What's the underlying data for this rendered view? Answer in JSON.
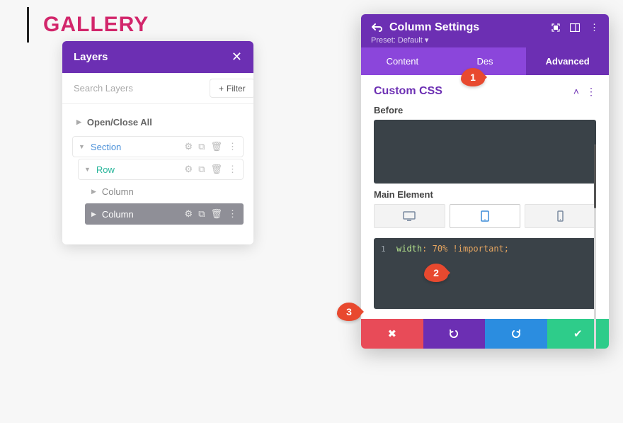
{
  "page_title": "GALLERY",
  "layers": {
    "title": "Layers",
    "search_placeholder": "Search Layers",
    "filter_label": "Filter",
    "open_close": "Open/Close All",
    "tree": {
      "section": "Section",
      "row": "Row",
      "column_a": "Column",
      "column_b": "Column"
    }
  },
  "settings": {
    "back_icon": "back",
    "title": "Column Settings",
    "preset_label": "Preset: Default",
    "tabs": {
      "content": "Content",
      "design_partial": "Des",
      "advanced": "Advanced"
    },
    "section_name": "Custom CSS",
    "before_label": "Before",
    "main_element_label": "Main Element",
    "code": {
      "line_no": "1",
      "prop": "width",
      "colon": ":",
      "value": "70%",
      "important": "!important",
      "semi": ";"
    }
  },
  "callouts": {
    "c1": "1",
    "c2": "2",
    "c3": "3"
  }
}
